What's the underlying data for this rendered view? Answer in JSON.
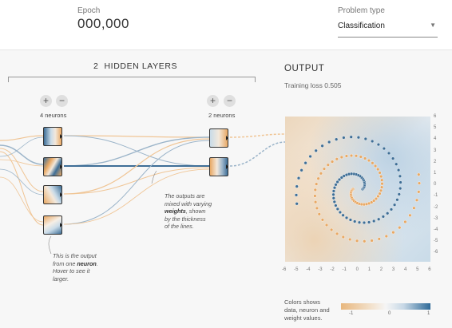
{
  "header": {
    "epoch_label": "Epoch",
    "epoch_value": "000,000",
    "problem_type_label": "Problem type",
    "problem_type_value": "Classification"
  },
  "network": {
    "hidden_layers_count": "2",
    "hidden_layers_title": "HIDDEN LAYERS",
    "add_symbol": "+",
    "remove_symbol": "−",
    "layer1_neurons": "4 neurons",
    "layer2_neurons": "2 neurons",
    "note_weights_pre": "The outputs are",
    "note_weights_mid": "mixed with varying",
    "note_weights_bold": "weights",
    "note_weights_post1": ", shown",
    "note_weights_post2": "by the thickness",
    "note_weights_post3": "of the lines.",
    "note_neuron_l1": "This is the output",
    "note_neuron_pre": "from one ",
    "note_neuron_bold": "neuron",
    "note_neuron_post": ".",
    "note_neuron_l3": "Hover to see it",
    "note_neuron_l4": "larger."
  },
  "output": {
    "title": "OUTPUT",
    "training_loss": "Training loss 0.505",
    "y_ticks": [
      "6",
      "5",
      "4",
      "3",
      "2",
      "1",
      "0",
      "-1",
      "-2",
      "-3",
      "-4",
      "-5",
      "-6"
    ],
    "x_ticks": [
      "-6",
      "-5",
      "-4",
      "-3",
      "-2",
      "-1",
      "0",
      "1",
      "2",
      "3",
      "4",
      "5",
      "6"
    ],
    "legend_l1": "Colors shows",
    "legend_l2": "data, neuron and",
    "legend_l3": "weight values.",
    "legend_min": "-1",
    "legend_mid": "0",
    "legend_max": "1"
  },
  "colors": {
    "orange": "#e8a864",
    "blue": "#3e6e96",
    "link_orange": "#f0c595",
    "link_blue": "#9bb4c9"
  }
}
